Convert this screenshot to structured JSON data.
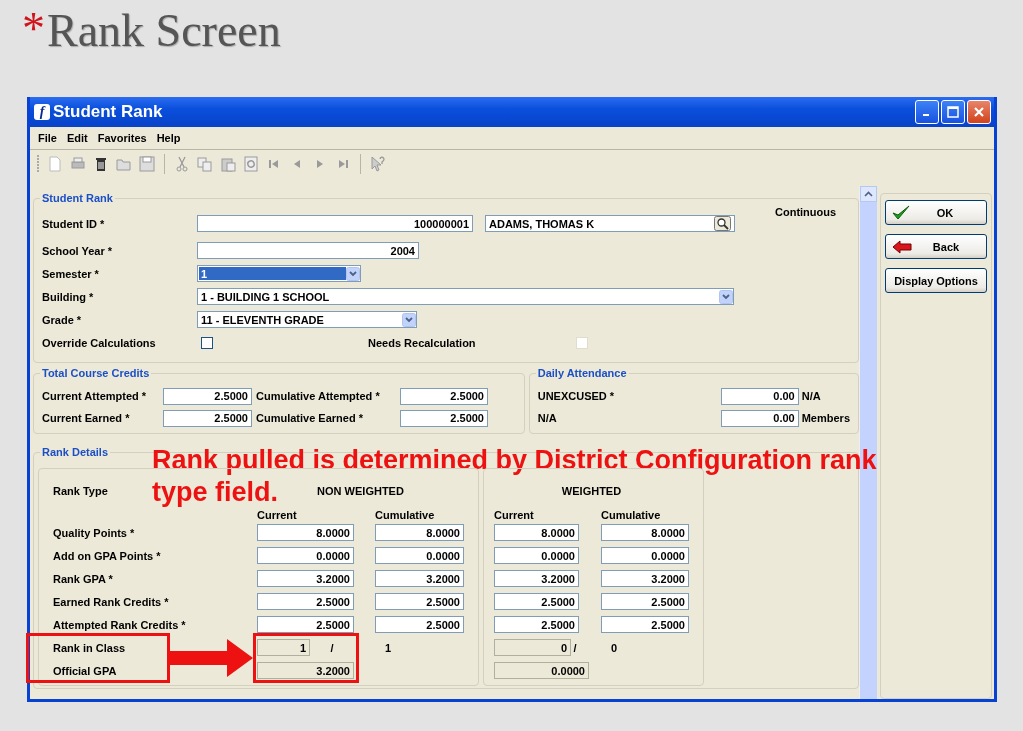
{
  "slide": {
    "title_mark": "*",
    "title": "Rank Screen"
  },
  "window": {
    "app_icon_letter": "f",
    "title": "Student Rank"
  },
  "menu": [
    {
      "label": "File"
    },
    {
      "label": "Edit"
    },
    {
      "label": "Favorites"
    },
    {
      "label": "Help"
    }
  ],
  "student_rank": {
    "legend": "Student Rank",
    "continuous_label": "Continuous",
    "student_id": {
      "label": "Student ID *",
      "value": "100000001",
      "name_value": "ADAMS, THOMAS K"
    },
    "school_year": {
      "label": "School Year *",
      "value": "2004"
    },
    "semester": {
      "label": "Semester *",
      "value": "1",
      "selected": true
    },
    "building": {
      "label": "Building *",
      "value": "1 - BUILDING 1 SCHOOL"
    },
    "grade": {
      "label": "Grade *",
      "value": "11 - ELEVENTH GRADE"
    },
    "override": {
      "label": "Override Calculations",
      "checked": false
    },
    "needs_recalc": {
      "label": "Needs Recalculation",
      "checked": false
    }
  },
  "total_course_credits": {
    "legend": "Total Course Credits",
    "rows": [
      {
        "label": "Current Attempted *",
        "value": "2.5000",
        "cum_label": "Cumulative Attempted *",
        "cum_value": "2.5000"
      },
      {
        "label": "Current Earned *",
        "value": "2.5000",
        "cum_label": "Cumulative Earned *",
        "cum_value": "2.5000"
      }
    ]
  },
  "daily_attendance": {
    "legend": "Daily Attendance",
    "rows": [
      {
        "label": "UNEXCUSED *",
        "value": "0.00",
        "suffix": "N/A"
      },
      {
        "label": "N/A",
        "value": "0.00",
        "suffix": "Members"
      }
    ]
  },
  "rank_details": {
    "legend": "Rank Details",
    "rank_type_label": "Rank Type",
    "groups": [
      {
        "title": "NON WEIGHTED",
        "columns": [
          "Current",
          "Cumulative"
        ]
      },
      {
        "title": "WEIGHTED",
        "columns": [
          "Current",
          "Cumulative"
        ]
      }
    ],
    "rows": [
      {
        "label": "Quality Points *",
        "values": [
          "8.0000",
          "8.0000",
          "8.0000",
          "8.0000"
        ]
      },
      {
        "label": "Add on GPA Points *",
        "values": [
          "0.0000",
          "0.0000",
          "0.0000",
          "0.0000"
        ]
      },
      {
        "label": "Rank GPA *",
        "values": [
          "3.2000",
          "3.2000",
          "3.2000",
          "3.2000"
        ]
      },
      {
        "label": "Earned Rank Credits *",
        "values": [
          "2.5000",
          "2.5000",
          "2.5000",
          "2.5000"
        ]
      },
      {
        "label": "Attempted Rank Credits *",
        "values": [
          "2.5000",
          "2.5000",
          "2.5000",
          "2.5000"
        ]
      }
    ],
    "rank_in_class": {
      "label": "Rank in Class",
      "groups": [
        {
          "rank": "1",
          "separator": "/",
          "total": "1"
        },
        {
          "rank": "0",
          "separator": "/",
          "total": "0"
        }
      ]
    },
    "official_gpa": {
      "label": "Official GPA",
      "values": [
        "3.2000",
        "0.0000"
      ]
    }
  },
  "annotation": {
    "lines": [
      "Rank pulled is determined by District Configuration rank",
      "type field."
    ]
  },
  "buttons": [
    {
      "label": "OK",
      "kind": "ok"
    },
    {
      "label": "Back",
      "kind": "back"
    },
    {
      "label": "Display Options",
      "kind": "plain"
    }
  ]
}
